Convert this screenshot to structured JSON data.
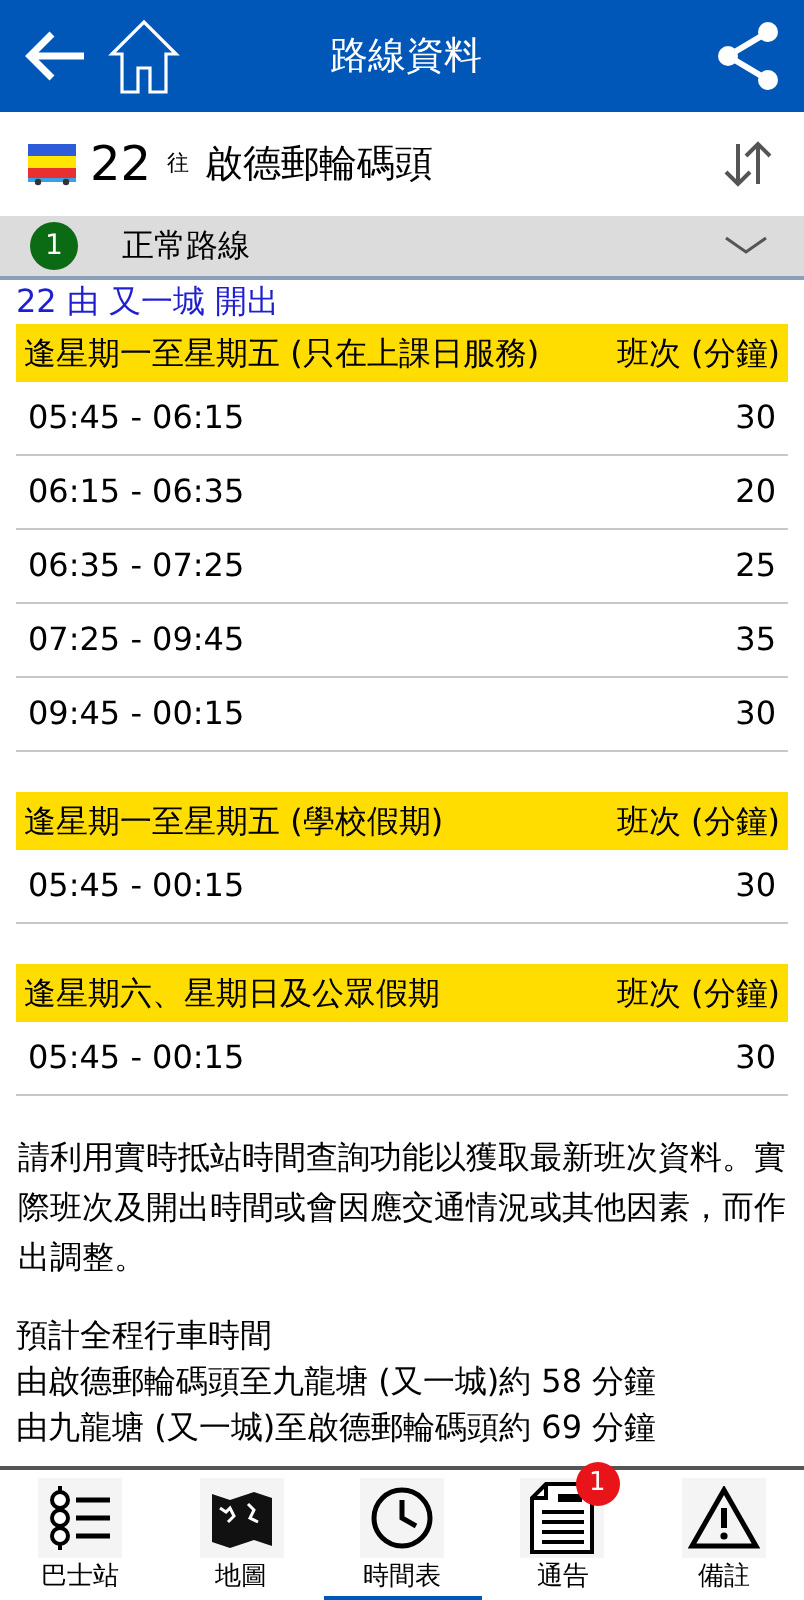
{
  "header": {
    "title": "路線資料"
  },
  "route": {
    "number": "22",
    "to_label": "往",
    "destination": "啟德郵輪碼頭"
  },
  "variant": {
    "index": "1",
    "name": "正常路線",
    "expanded": false
  },
  "departure": "22 由 又一城 開出",
  "timetables": [
    {
      "heading": "逢星期一至星期五 (只在上課日服務)",
      "freq_heading": "班次 (分鐘)",
      "rows": [
        {
          "period": "05:45 - 06:15",
          "freq": "30"
        },
        {
          "period": "06:15 - 06:35",
          "freq": "20"
        },
        {
          "period": "06:35 - 07:25",
          "freq": "25"
        },
        {
          "period": "07:25 - 09:45",
          "freq": "35"
        },
        {
          "period": "09:45 - 00:15",
          "freq": "30"
        }
      ]
    },
    {
      "heading": "逢星期一至星期五 (學校假期)",
      "freq_heading": "班次 (分鐘)",
      "rows": [
        {
          "period": "05:45 - 00:15",
          "freq": "30"
        }
      ]
    },
    {
      "heading": "逢星期六、星期日及公眾假期",
      "freq_heading": "班次 (分鐘)",
      "rows": [
        {
          "period": "05:45 - 00:15",
          "freq": "30"
        }
      ]
    }
  ],
  "notes": [
    "請利用實時抵站時間查詢功能以獲取最新班次資料。實際班次及開出時間或會因應交通情況或其他因素，而作出調整。"
  ],
  "journey_time": {
    "title": "預計全程行車時間",
    "lines": [
      "由啟德郵輪碼頭至九龍塘 (又一城)約 58 分鐘",
      "由九龍塘 (又一城)至啟德郵輪碼頭約 69 分鐘"
    ]
  },
  "tabs": [
    {
      "kind": "stops",
      "label": "巴士站",
      "selected": false
    },
    {
      "kind": "map",
      "label": "地圖",
      "selected": false
    },
    {
      "kind": "timetable",
      "label": "時間表",
      "selected": true
    },
    {
      "kind": "notice",
      "label": "通告",
      "selected": false,
      "badge": "1"
    },
    {
      "kind": "remarks",
      "label": "備註",
      "selected": false
    }
  ]
}
